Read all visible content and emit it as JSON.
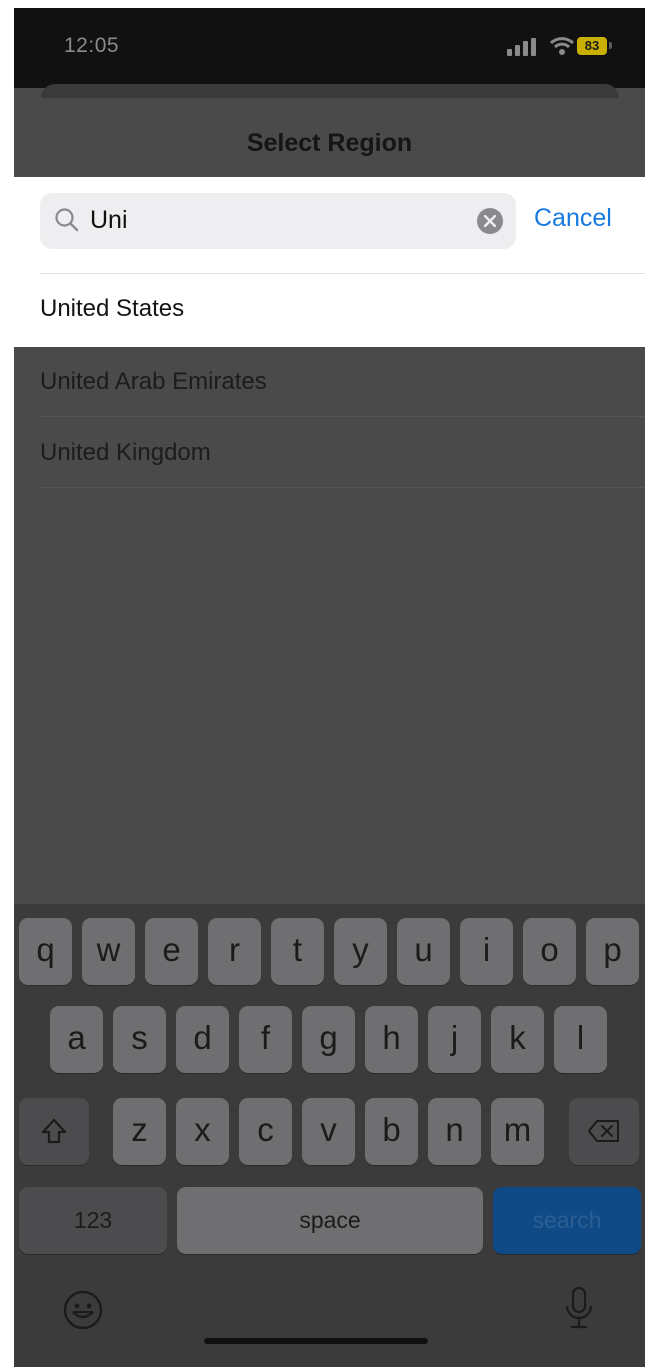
{
  "status_bar": {
    "time": "12:05",
    "battery": "83",
    "battery_color": "#c9b000"
  },
  "sheet": {
    "title": "Select Region"
  },
  "search": {
    "query": "Uni",
    "cancel_label": "Cancel",
    "accent_color": "#1a7ae0"
  },
  "results": [
    {
      "label": "United States",
      "highlighted": true
    },
    {
      "label": "United Arab Emirates",
      "highlighted": false
    },
    {
      "label": "United Kingdom",
      "highlighted": false
    }
  ],
  "keyboard": {
    "row1": [
      "q",
      "w",
      "e",
      "r",
      "t",
      "y",
      "u",
      "i",
      "o",
      "p"
    ],
    "row2": [
      "a",
      "s",
      "d",
      "f",
      "g",
      "h",
      "j",
      "k",
      "l"
    ],
    "row3": [
      "z",
      "x",
      "c",
      "v",
      "b",
      "n",
      "m"
    ],
    "numbers_label": "123",
    "space_label": "space",
    "search_label": "search",
    "icons": [
      "shift-icon",
      "backspace-icon",
      "emoji-icon",
      "microphone-icon"
    ]
  }
}
